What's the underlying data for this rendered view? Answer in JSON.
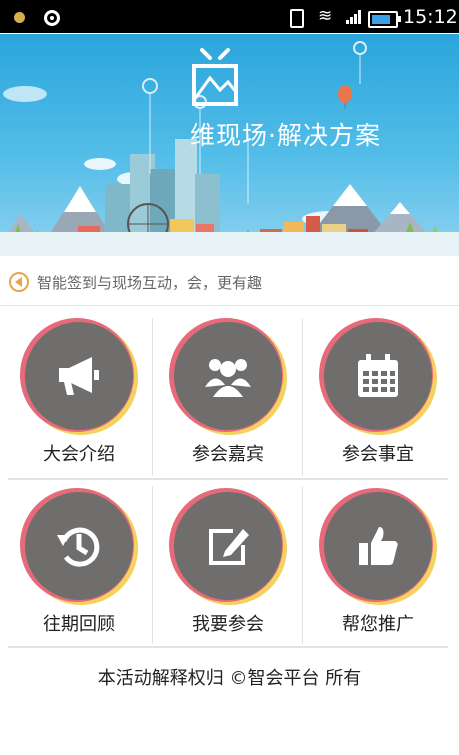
{
  "status_bar": {
    "time": "15:12"
  },
  "banner": {
    "title": "维现场·解决方案"
  },
  "notice": {
    "text": "智能签到与现场互动，会，更有趣"
  },
  "menu": [
    {
      "label": "大会介绍",
      "icon": "megaphone-icon"
    },
    {
      "label": "参会嘉宾",
      "icon": "people-icon"
    },
    {
      "label": "参会事宜",
      "icon": "calendar-icon"
    },
    {
      "label": "往期回顾",
      "icon": "history-icon"
    },
    {
      "label": "我要参会",
      "icon": "edit-icon"
    },
    {
      "label": "帮您推广",
      "icon": "thumbs-up-icon"
    }
  ],
  "footer": {
    "text": "本活动解释权归 ©智会平台 所有"
  },
  "colors": {
    "circle": "#6f6e6c",
    "ring_red": "#e66a7a",
    "ring_yellow": "#f3d25f",
    "sky": "#2aa5dc"
  }
}
